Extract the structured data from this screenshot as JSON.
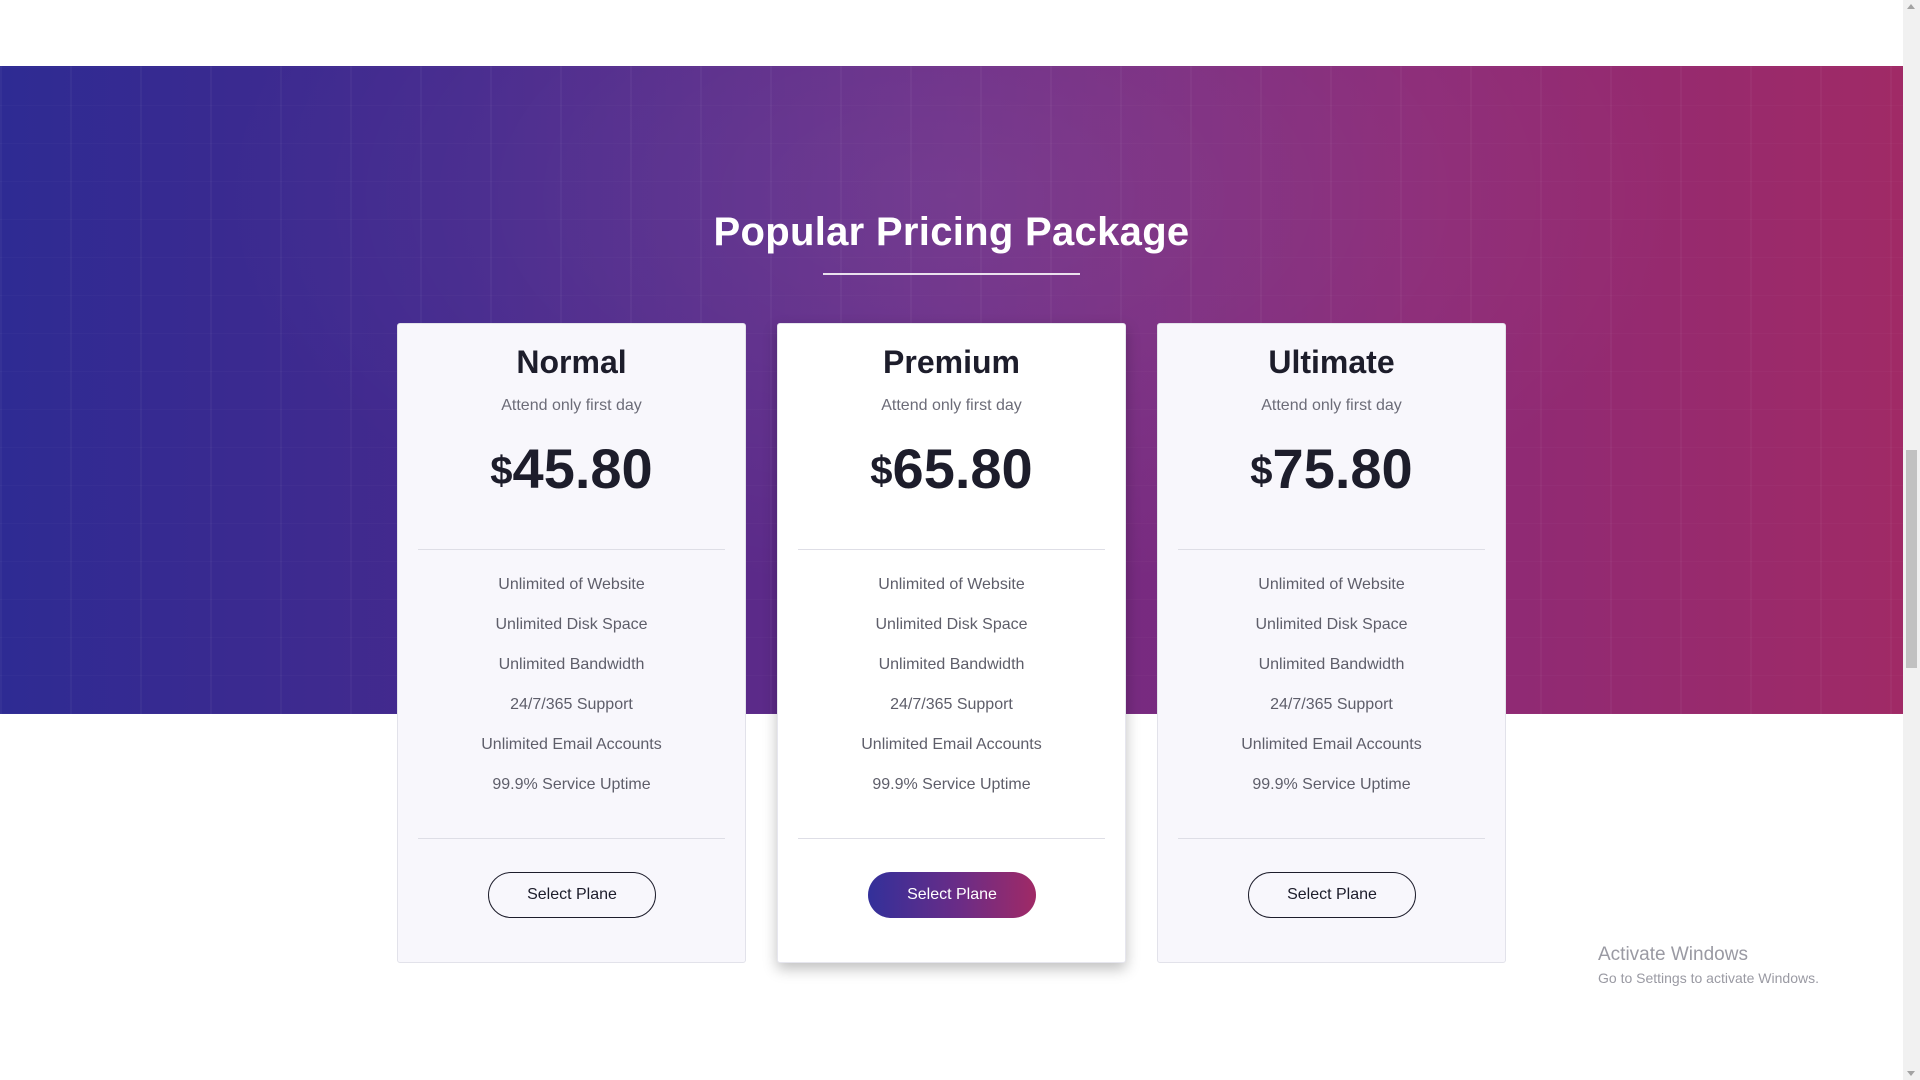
{
  "section": {
    "title": "Popular Pricing Package"
  },
  "colors": {
    "gradient_start": "#2e2b93",
    "gradient_end": "#a02a66",
    "text_dark": "#1d1d2b",
    "text_muted": "#6c6c78"
  },
  "plans": [
    {
      "name": "Normal",
      "subtitle": "Attend only first day",
      "currency": "$",
      "price": "45.80",
      "features": [
        "Unlimited of Website",
        "Unlimited Disk Space",
        "Unlimited Bandwidth",
        "24/7/365 Support",
        "Unlimited Email Accounts",
        "99.9% Service Uptime"
      ],
      "button_label": "Select Plane"
    },
    {
      "name": "Premium",
      "subtitle": "Attend only first day",
      "currency": "$",
      "price": "65.80",
      "features": [
        "Unlimited of Website",
        "Unlimited Disk Space",
        "Unlimited Bandwidth",
        "24/7/365 Support",
        "Unlimited Email Accounts",
        "99.9% Service Uptime"
      ],
      "button_label": "Select Plane"
    },
    {
      "name": "Ultimate",
      "subtitle": "Attend only first day",
      "currency": "$",
      "price": "75.80",
      "features": [
        "Unlimited of Website",
        "Unlimited Disk Space",
        "Unlimited Bandwidth",
        "24/7/365 Support",
        "Unlimited Email Accounts",
        "99.9% Service Uptime"
      ],
      "button_label": "Select Plane"
    }
  ],
  "watermark": {
    "title": "Activate Windows",
    "subtitle": "Go to Settings to activate Windows."
  }
}
